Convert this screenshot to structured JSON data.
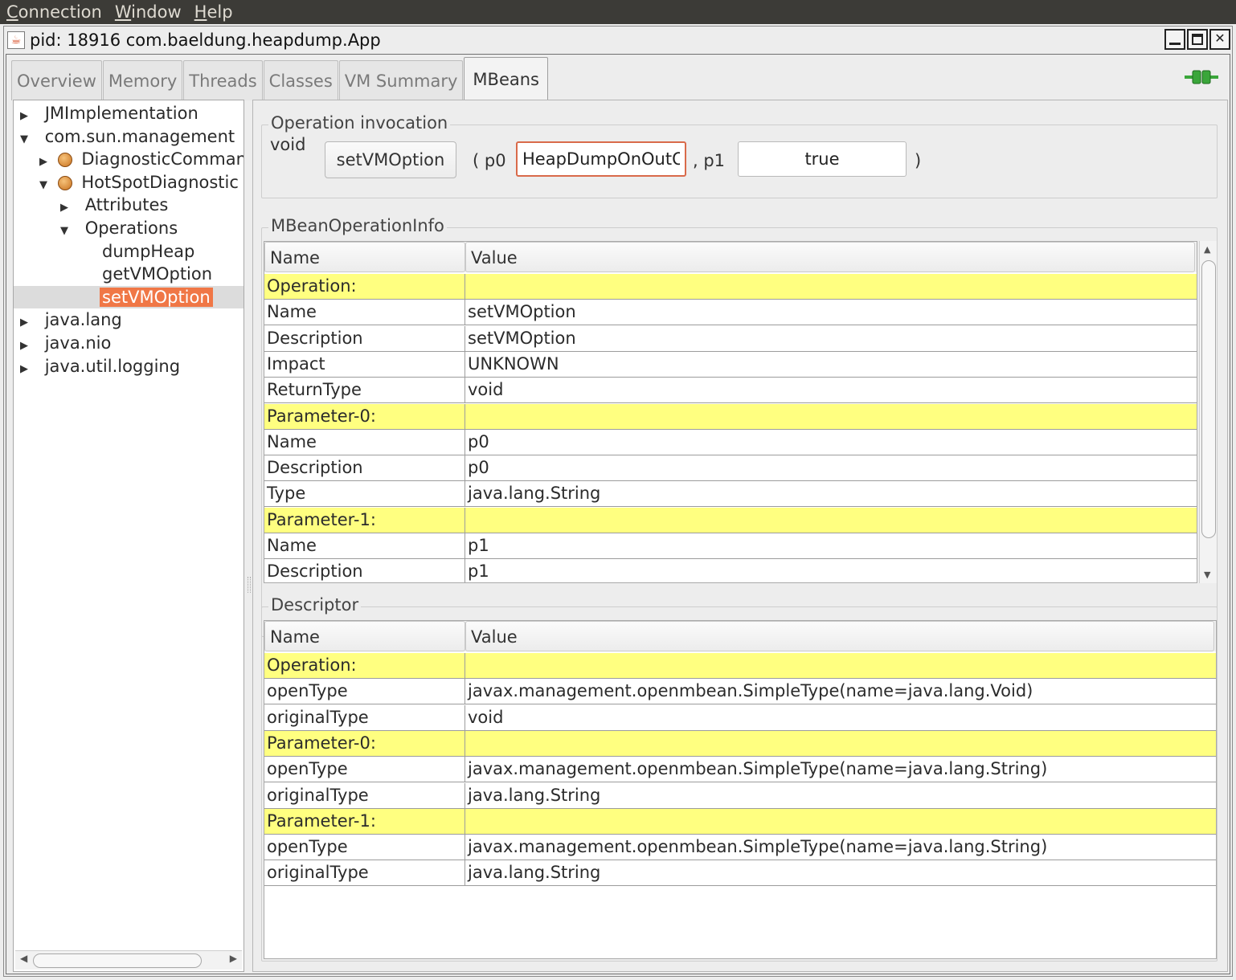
{
  "menu": {
    "items": [
      {
        "mnemonic": "C",
        "rest": "onnection"
      },
      {
        "mnemonic": "W",
        "rest": "indow"
      },
      {
        "mnemonic": "H",
        "rest": "elp"
      }
    ]
  },
  "window": {
    "title": "pid: 18916 com.baeldung.heapdump.App"
  },
  "tabs": [
    "Overview",
    "Memory",
    "Threads",
    "Classes",
    "VM Summary",
    "MBeans"
  ],
  "active_tab": "MBeans",
  "tree": {
    "nodes": [
      {
        "label": "JMImplementation",
        "toggle": "▶"
      },
      {
        "label": "com.sun.management",
        "toggle": "▼"
      },
      {
        "label": "DiagnosticCommand",
        "toggle": "▶"
      },
      {
        "label": "HotSpotDiagnostic",
        "toggle": "▼"
      },
      {
        "label": "Attributes",
        "toggle": "▶"
      },
      {
        "label": "Operations",
        "toggle": "▼"
      },
      {
        "label": "dumpHeap",
        "toggle": ""
      },
      {
        "label": "getVMOption",
        "toggle": ""
      },
      {
        "label": "setVMOption",
        "toggle": ""
      },
      {
        "label": "java.lang",
        "toggle": "▶"
      },
      {
        "label": "java.nio",
        "toggle": "▶"
      },
      {
        "label": "java.util.logging",
        "toggle": "▶"
      }
    ]
  },
  "invocation": {
    "group_label": "Operation invocation",
    "return_type": "void",
    "operation_button": "setVMOption",
    "open_paren": "( p0",
    "p0_value": "HeapDumpOnOutOfMemoryError",
    "sep_p1": ", p1",
    "p1_value": "true",
    "close_paren": ")"
  },
  "operation_info": {
    "group_label": "MBeanOperationInfo",
    "headers": [
      "Name",
      "Value"
    ],
    "rows": [
      {
        "name": "Operation:",
        "value": "",
        "section": true
      },
      {
        "name": "Name",
        "value": "setVMOption",
        "section": false
      },
      {
        "name": "Description",
        "value": "setVMOption",
        "section": false
      },
      {
        "name": "Impact",
        "value": "UNKNOWN",
        "section": false
      },
      {
        "name": "ReturnType",
        "value": "void",
        "section": false
      },
      {
        "name": "Parameter-0:",
        "value": "",
        "section": true
      },
      {
        "name": "Name",
        "value": "p0",
        "section": false
      },
      {
        "name": "Description",
        "value": "p0",
        "section": false
      },
      {
        "name": "Type",
        "value": "java.lang.String",
        "section": false
      },
      {
        "name": "Parameter-1:",
        "value": "",
        "section": true
      },
      {
        "name": "Name",
        "value": "p1",
        "section": false
      },
      {
        "name": "Description",
        "value": "p1",
        "section": false
      }
    ]
  },
  "descriptor": {
    "group_label": "Descriptor",
    "headers": [
      "Name",
      "Value"
    ],
    "rows": [
      {
        "name": "Operation:",
        "value": "",
        "section": true
      },
      {
        "name": "openType",
        "value": "javax.management.openmbean.SimpleType(name=java.lang.Void)",
        "section": false
      },
      {
        "name": "originalType",
        "value": "void",
        "section": false
      },
      {
        "name": "Parameter-0:",
        "value": "",
        "section": true
      },
      {
        "name": "openType",
        "value": "javax.management.openmbean.SimpleType(name=java.lang.String)",
        "section": false
      },
      {
        "name": "originalType",
        "value": "java.lang.String",
        "section": false
      },
      {
        "name": "Parameter-1:",
        "value": "",
        "section": true
      },
      {
        "name": "openType",
        "value": "javax.management.openmbean.SimpleType(name=java.lang.String)",
        "section": false
      },
      {
        "name": "originalType",
        "value": "java.lang.String",
        "section": false
      }
    ]
  },
  "colors": {
    "section_row": "#ffff80",
    "tree_selection": "#f07746",
    "connect_icon": "#3aa63a"
  },
  "icons": {
    "window": "java-cup-icon",
    "connection": "connected-plug-icon",
    "bean": "mbean-icon"
  }
}
